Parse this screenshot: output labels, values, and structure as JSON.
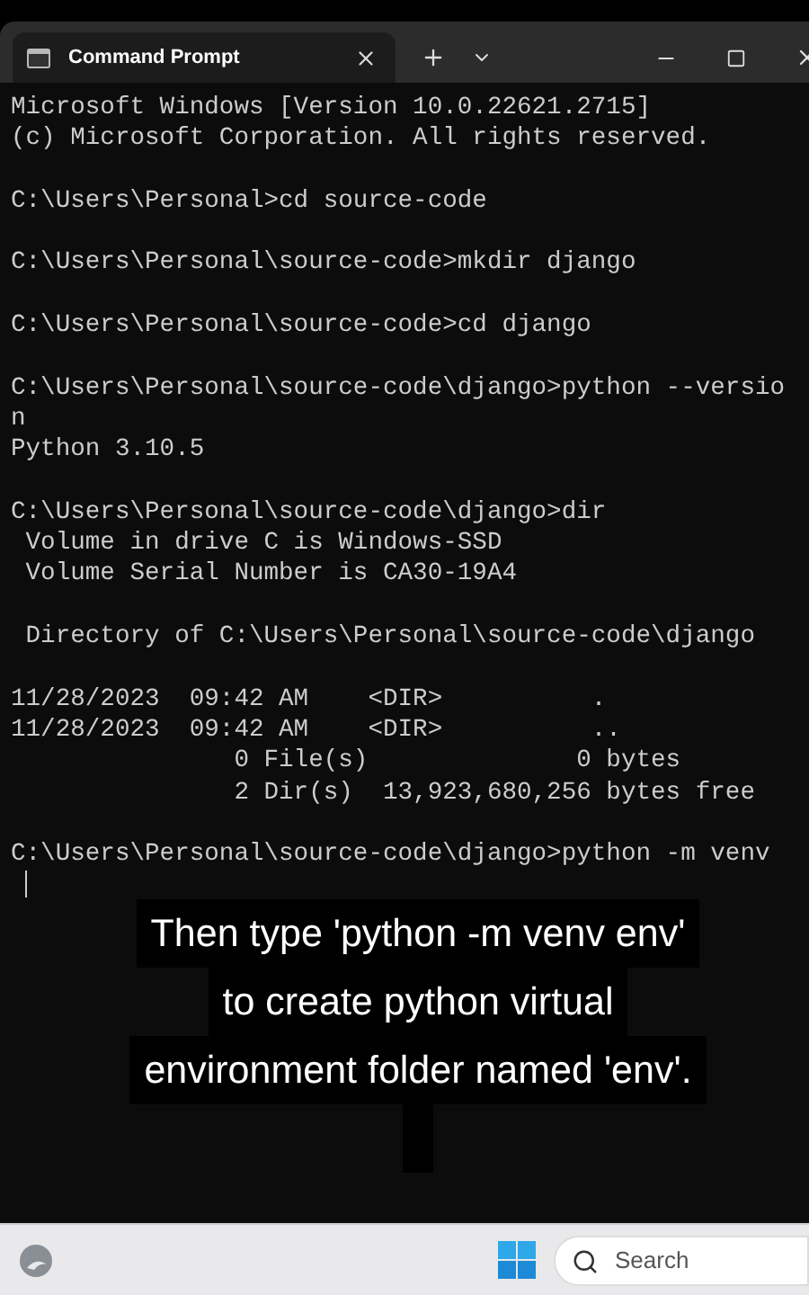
{
  "tabs": [
    {
      "label": "Command Prompt",
      "selected": true
    }
  ],
  "terminal": {
    "blocks": [
      [
        "Microsoft Windows [Version 10.0.22621.2715]",
        "(c) Microsoft Corporation. All rights reserved."
      ],
      [
        "C:\\Users\\Personal>cd source-code"
      ],
      [
        "C:\\Users\\Personal\\source-code>mkdir django"
      ],
      [
        "C:\\Users\\Personal\\source-code>cd django"
      ],
      [
        "C:\\Users\\Personal\\source-code\\django>python --versio",
        "n",
        "Python 3.10.5"
      ],
      [
        "C:\\Users\\Personal\\source-code\\django>dir",
        " Volume in drive C is Windows-SSD",
        " Volume Serial Number is CA30-19A4"
      ],
      [
        " Directory of C:\\Users\\Personal\\source-code\\django"
      ],
      [
        "11/28/2023  09:42 AM    <DIR>          .",
        "11/28/2023  09:42 AM    <DIR>          ..",
        "               0 File(s)              0 bytes",
        "               2 Dir(s)  13,923,680,256 bytes free"
      ],
      [
        "C:\\Users\\Personal\\source-code\\django>python -m venv"
      ]
    ],
    "cursor_visible": true
  },
  "caption": {
    "lines": [
      "Then type 'python -m venv env'",
      "to create python virtual",
      "environment folder named 'env'."
    ]
  },
  "taskbar": {
    "search": {
      "placeholder": "Search"
    }
  }
}
